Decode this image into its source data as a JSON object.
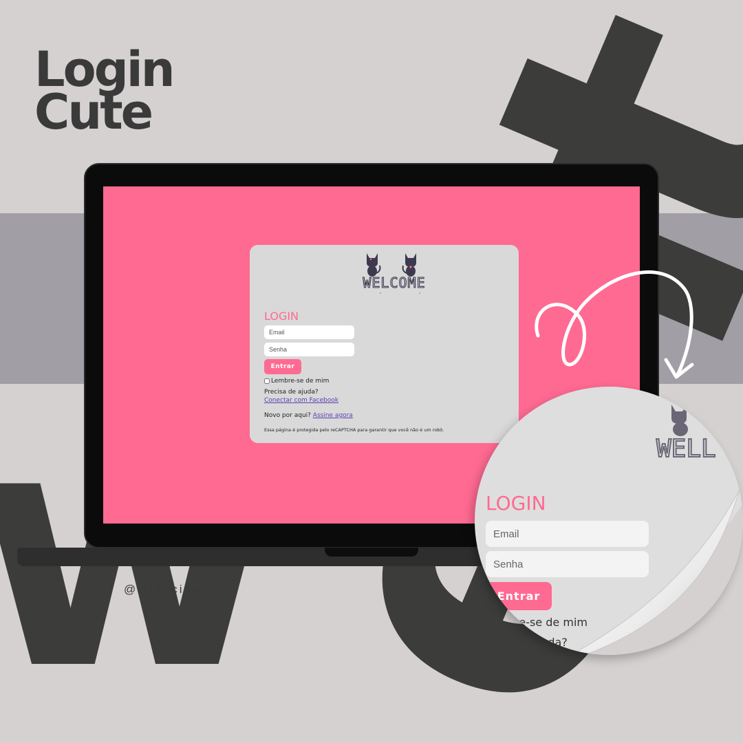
{
  "colors": {
    "background": "#d4d1d0",
    "band": "#a19ea6",
    "screen_pink": "#ff6a92",
    "card": "#d9d9d9",
    "dark_text": "#3a3a3a",
    "link": "#5d3fb3"
  },
  "hero": {
    "title_line1": "Login",
    "title_line2": "Cute"
  },
  "handle": "@ francinedds",
  "background_letters": {
    "left": "w",
    "rotated": "ent"
  },
  "login_card": {
    "logo_text": "WELCOME",
    "title": "LOGIN",
    "email_placeholder": "Email",
    "password_placeholder": "Senha",
    "submit_label": "Entrar",
    "remember_label": "Lembre-se de mim",
    "help_text": "Precisa de ajuda?",
    "facebook_link": "Conectar com Facebook",
    "signup_prefix": "Novo por aqui?",
    "signup_link": "Assine agora",
    "captcha_notice": "Essa página é protegida pelo reCAPTCHA para garantir que você não é um robô."
  },
  "zoom_sticker": {
    "logo_fragment": "WELL",
    "title": "LOGIN",
    "email_placeholder": "Email",
    "password_placeholder": "Senha",
    "submit_label": "Entrar",
    "remember_fragment": "bre-se de mim",
    "help_fragment": "ajuda?"
  }
}
